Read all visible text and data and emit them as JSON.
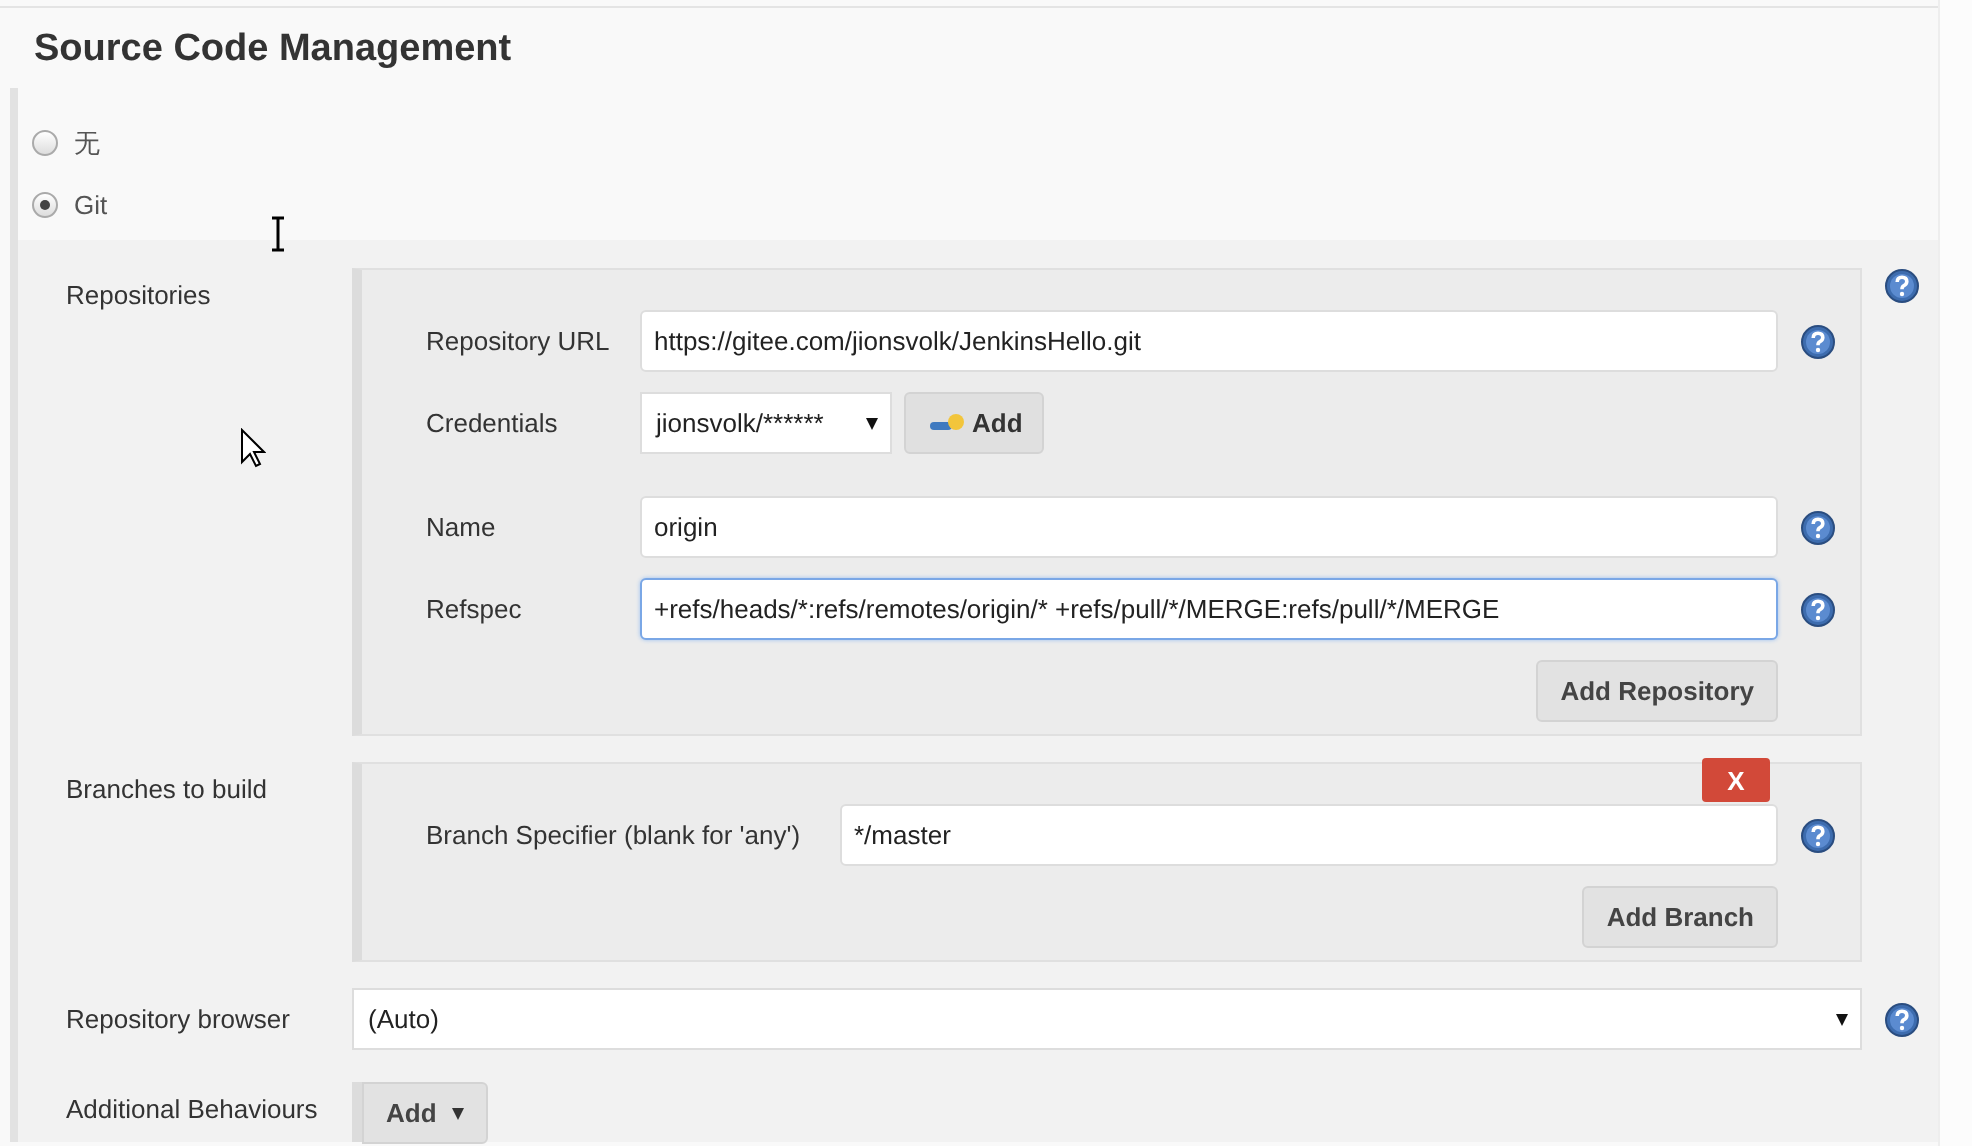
{
  "section_title": "Source Code Management",
  "scm_options": [
    {
      "label": "无",
      "selected": false
    },
    {
      "label": "Git",
      "selected": true
    }
  ],
  "repositories": {
    "label": "Repositories",
    "fields": [
      {
        "label": "Repository URL",
        "kind": "text",
        "value": "https://gitee.com/jionsvolk/JenkinsHello.git",
        "focused": false
      },
      {
        "label": "Credentials",
        "kind": "select",
        "value": "jionsvolk/******",
        "button": "Add"
      },
      {
        "label": "Name",
        "kind": "text",
        "value": "origin",
        "focused": false
      },
      {
        "label": "Refspec",
        "kind": "text",
        "value": "+refs/heads/*:refs/remotes/origin/* +refs/pull/*/MERGE:refs/pull/*/MERGE",
        "focused": true
      }
    ],
    "add_button": "Add Repository"
  },
  "branches": {
    "label": "Branches to build",
    "delete_button": "X",
    "fields": [
      {
        "label": "Branch Specifier (blank for 'any')",
        "kind": "text",
        "value": "*/master",
        "focused": false
      }
    ],
    "add_button": "Add Branch"
  },
  "repository_browser": {
    "label": "Repository browser",
    "value": "(Auto)"
  },
  "additional_behaviours": {
    "label": "Additional Behaviours",
    "button": "Add"
  }
}
